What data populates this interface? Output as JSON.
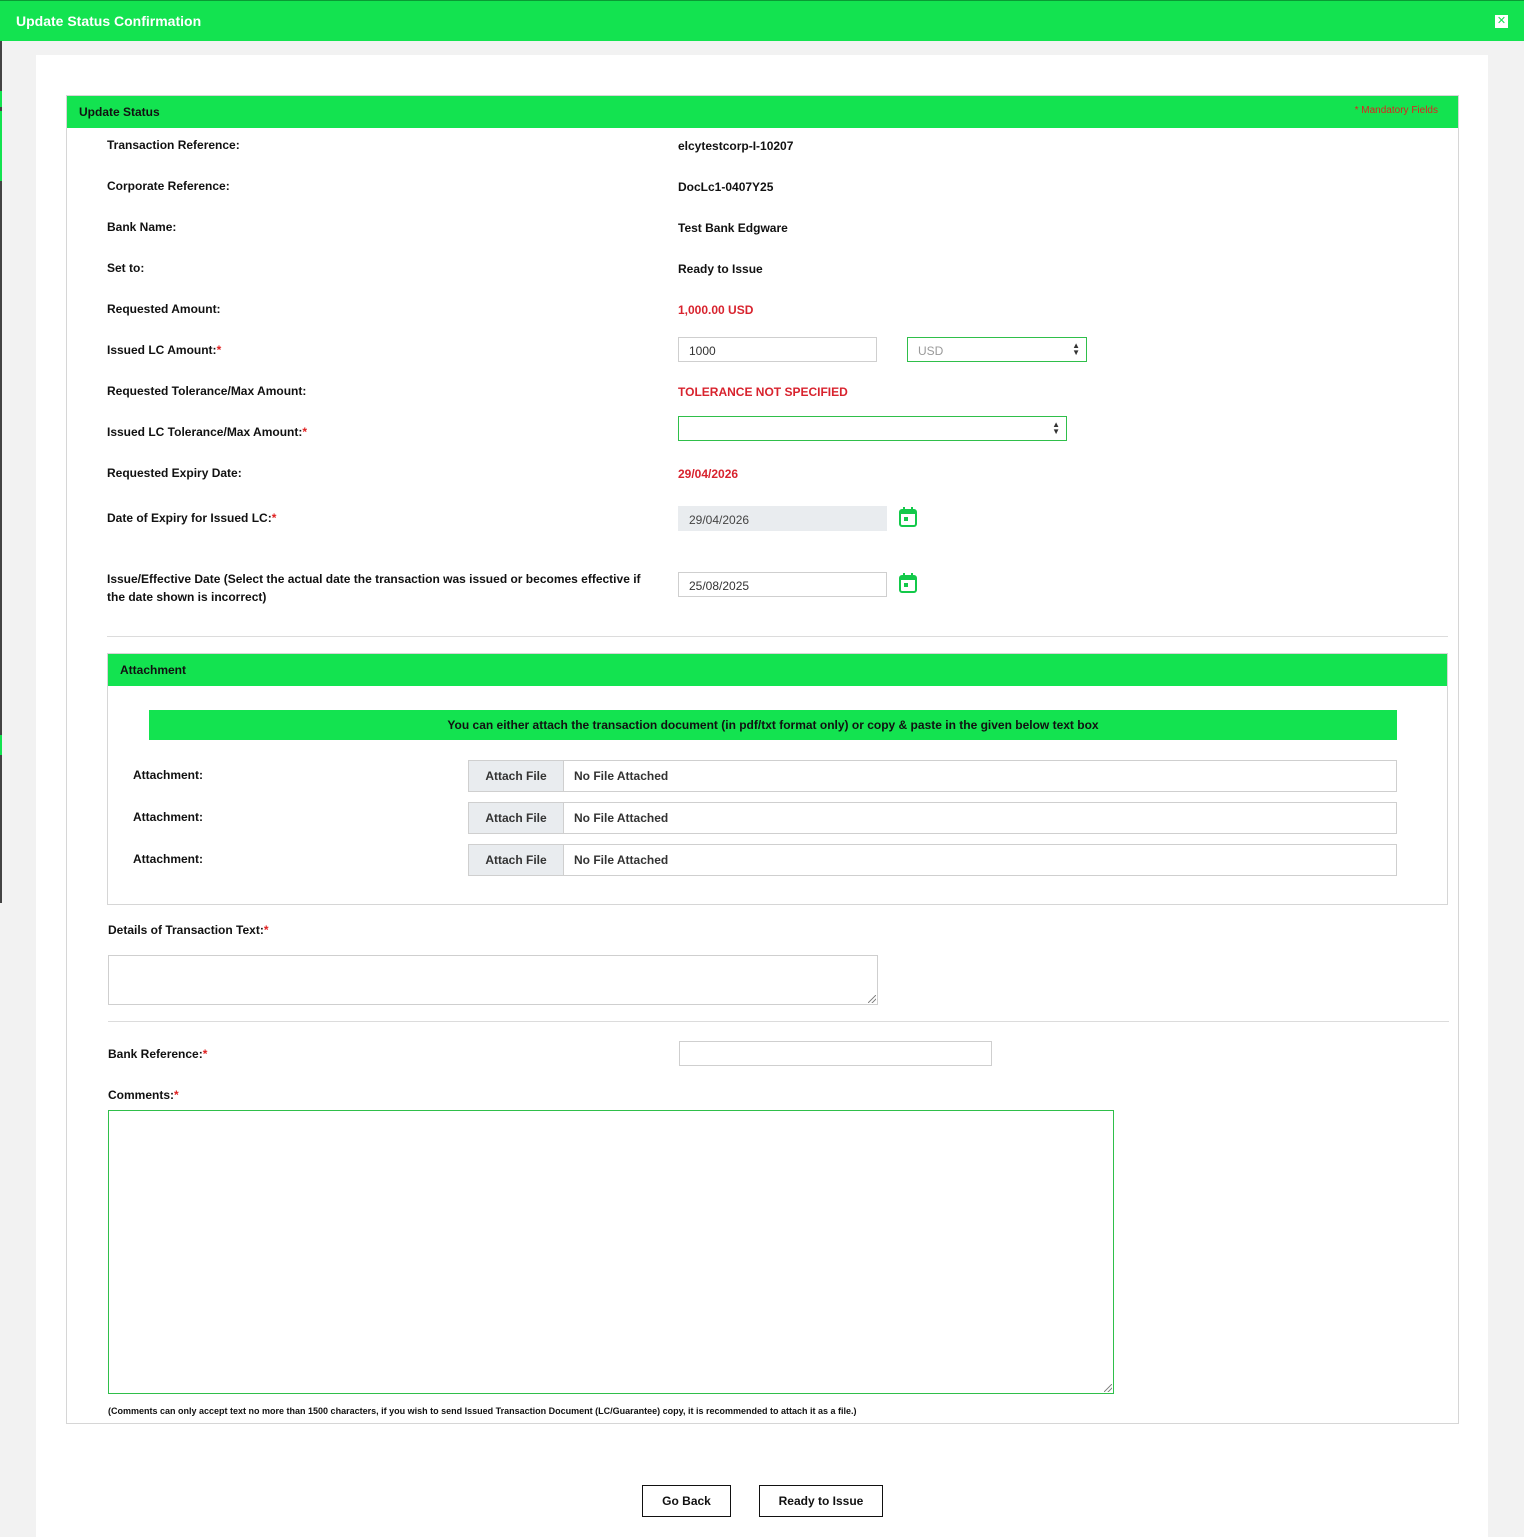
{
  "modal": {
    "title": "Update Status Confirmation",
    "close_icon": "close-icon"
  },
  "panel": {
    "title": "Update Status",
    "mandatory_note": "* Mandatory Fields"
  },
  "fields": {
    "transaction_reference": {
      "label": "Transaction Reference:",
      "value": "elcytestcorp-I-10207"
    },
    "corporate_reference": {
      "label": "Corporate Reference:",
      "value": "DocLc1-0407Y25"
    },
    "bank_name": {
      "label": "Bank Name:",
      "value": "Test Bank Edgware"
    },
    "set_to": {
      "label": "Set to:",
      "value": "Ready to Issue"
    },
    "requested_amount": {
      "label": "Requested Amount:",
      "value": "1,000.00 USD"
    },
    "issued_lc_amount": {
      "label": "Issued LC Amount:",
      "req": "*",
      "value": "1000",
      "currency": "USD"
    },
    "requested_tolerance": {
      "label": "Requested Tolerance/Max Amount:",
      "value": "TOLERANCE NOT SPECIFIED"
    },
    "issued_tolerance": {
      "label": "Issued LC Tolerance/Max Amount:",
      "req": "*",
      "value": ""
    },
    "requested_expiry": {
      "label": "Requested Expiry Date:",
      "value": "29/04/2026"
    },
    "expiry_issued": {
      "label": "Date of Expiry for Issued LC:",
      "req": "*",
      "value": "29/04/2026"
    },
    "issue_effective": {
      "label": "Issue/Effective Date (Select the actual date the transaction was issued or becomes effective if the date shown is incorrect)",
      "value": "25/08/2025"
    }
  },
  "attachment": {
    "title": "Attachment",
    "banner": "You can either attach the transaction document (in pdf/txt format only) or copy & paste in the given below text box",
    "rows": [
      {
        "label": "Attachment:",
        "button": "Attach File",
        "status": "No File Attached"
      },
      {
        "label": "Attachment:",
        "button": "Attach File",
        "status": "No File Attached"
      },
      {
        "label": "Attachment:",
        "button": "Attach File",
        "status": "No File Attached"
      }
    ]
  },
  "details_text": {
    "label": "Details of Transaction Text:",
    "req": "*"
  },
  "bank_reference": {
    "label": "Bank Reference:",
    "req": "*",
    "value": ""
  },
  "comments": {
    "label": "Comments:",
    "req": "*",
    "note": "(Comments can only accept text no more than 1500 characters, if you wish to send Issued Transaction Document (LC/Guarantee) copy, it is recommended to attach it as a file.)"
  },
  "actions": {
    "go_back": "Go Back",
    "ready_to_issue": "Ready to Issue"
  },
  "colors": {
    "accent": "#13e350",
    "alert": "#d8232e",
    "required": "#e02020"
  }
}
